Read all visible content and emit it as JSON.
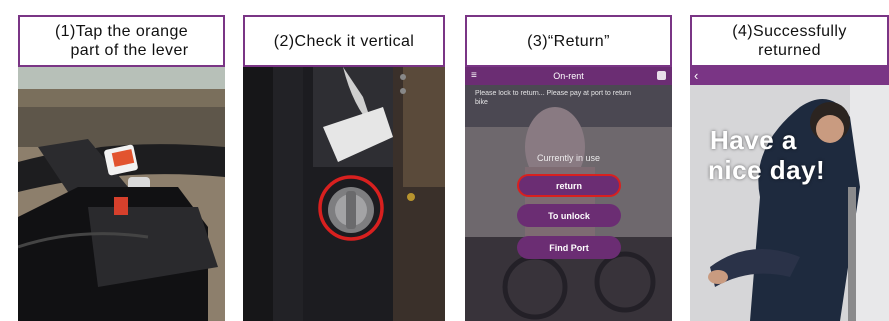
{
  "panels": [
    {
      "caption_line1": "(1)Tap the orange",
      "caption_line2": "part of the lever"
    },
    {
      "caption_line1": "(2)Check it vertical",
      "caption_line2": ""
    },
    {
      "caption_line1": "(3)“Return”",
      "caption_line2": ""
    },
    {
      "caption_line1": "(4)Successfully",
      "caption_line2": "returned"
    }
  ],
  "phone": {
    "header_title": "On-rent",
    "notice_text": "Please lock to return... Please pay at port to return bike",
    "status_text": "Currently in use",
    "buttons": [
      "return",
      "To unlock",
      "Find Port"
    ]
  },
  "success": {
    "message_line1": "Have a",
    "message_line2": "nice day!"
  },
  "colors": {
    "accent": "#7a3585",
    "app_purple": "#6b2d73",
    "highlight_red": "#d8201f",
    "lever_orange": "#e2542f"
  }
}
